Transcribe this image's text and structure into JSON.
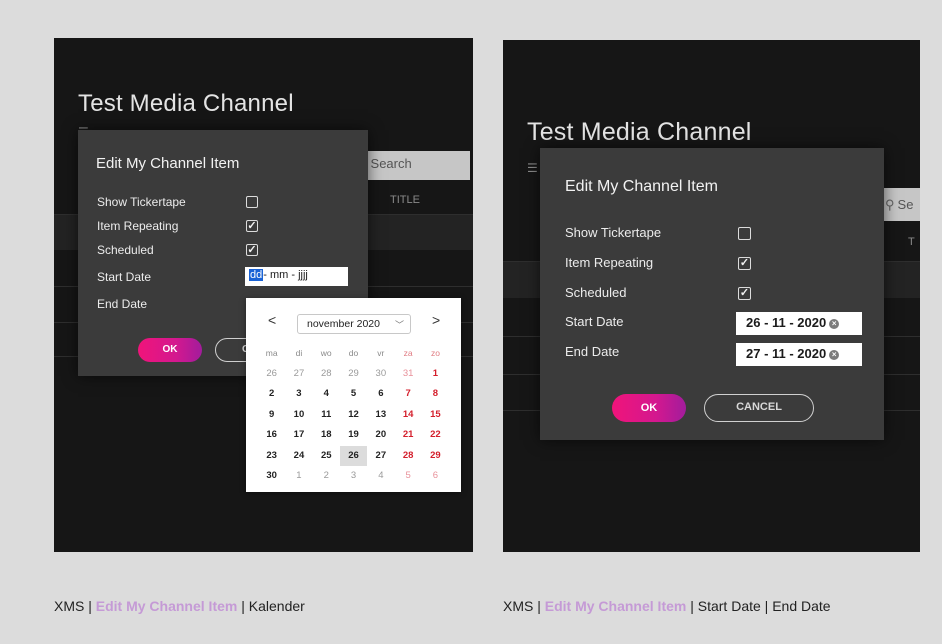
{
  "left": {
    "app_title": "Test Media Channel",
    "search_placeholder": "Search",
    "column_title": "TITLE",
    "dialog": {
      "title": "Edit My Channel Item",
      "show_tickertape": "Show Tickertape",
      "item_repeating": "Item Repeating",
      "scheduled": "Scheduled",
      "start_date": "Start Date",
      "end_date": "End Date",
      "ok_label": "OK",
      "cancel_partial": "C"
    },
    "checks": {
      "show_tickertape": false,
      "item_repeating": true,
      "scheduled": true
    },
    "date_input": {
      "dd": "dd",
      "sep1": "- ",
      "mm": "mm",
      "sep2": " - ",
      "yyyy": "jjjj"
    },
    "calendar": {
      "prev": "<",
      "next": ">",
      "month_label": "november 2020",
      "weekdays": [
        "ma",
        "di",
        "wo",
        "do",
        "vr",
        "za",
        "zo"
      ],
      "weeks": [
        [
          "26",
          "27",
          "28",
          "29",
          "30",
          "31",
          "1"
        ],
        [
          "2",
          "3",
          "4",
          "5",
          "6",
          "7",
          "8"
        ],
        [
          "9",
          "10",
          "11",
          "12",
          "13",
          "14",
          "15"
        ],
        [
          "16",
          "17",
          "18",
          "19",
          "20",
          "21",
          "22"
        ],
        [
          "23",
          "24",
          "25",
          "26",
          "27",
          "28",
          "29"
        ],
        [
          "30",
          "1",
          "2",
          "3",
          "4",
          "5",
          "6"
        ]
      ],
      "today": "26"
    }
  },
  "right": {
    "app_title": "Test Media Channel",
    "search_partial": "Se",
    "column_partial": "T",
    "dialog": {
      "title": "Edit My Channel Item",
      "show_tickertape": "Show Tickertape",
      "item_repeating": "Item Repeating",
      "scheduled": "Scheduled",
      "start_date": "Start Date",
      "end_date": "End Date",
      "ok_label": "OK",
      "cancel_label": "CANCEL"
    },
    "checks": {
      "show_tickertape": false,
      "item_repeating": true,
      "scheduled": true
    },
    "start_value": "26 - 11 - 2020",
    "end_value": "27 - 11 - 2020"
  },
  "captions": {
    "left": {
      "prefix": "XMS | ",
      "accent": "Edit My Channel Item",
      "suffix": " | Kalender"
    },
    "right": {
      "prefix": "XMS | ",
      "accent": "Edit My Channel Item",
      "suffix": " | Start Date | End Date"
    }
  },
  "colors": {
    "accent": "#c59ad6",
    "ok_button": "#f0147a",
    "weekend": "#d41f2c",
    "selection": "#1a63d6"
  },
  "icons": {
    "check": "✓",
    "clear": "×",
    "search": "search-icon",
    "list": "list-icon"
  }
}
